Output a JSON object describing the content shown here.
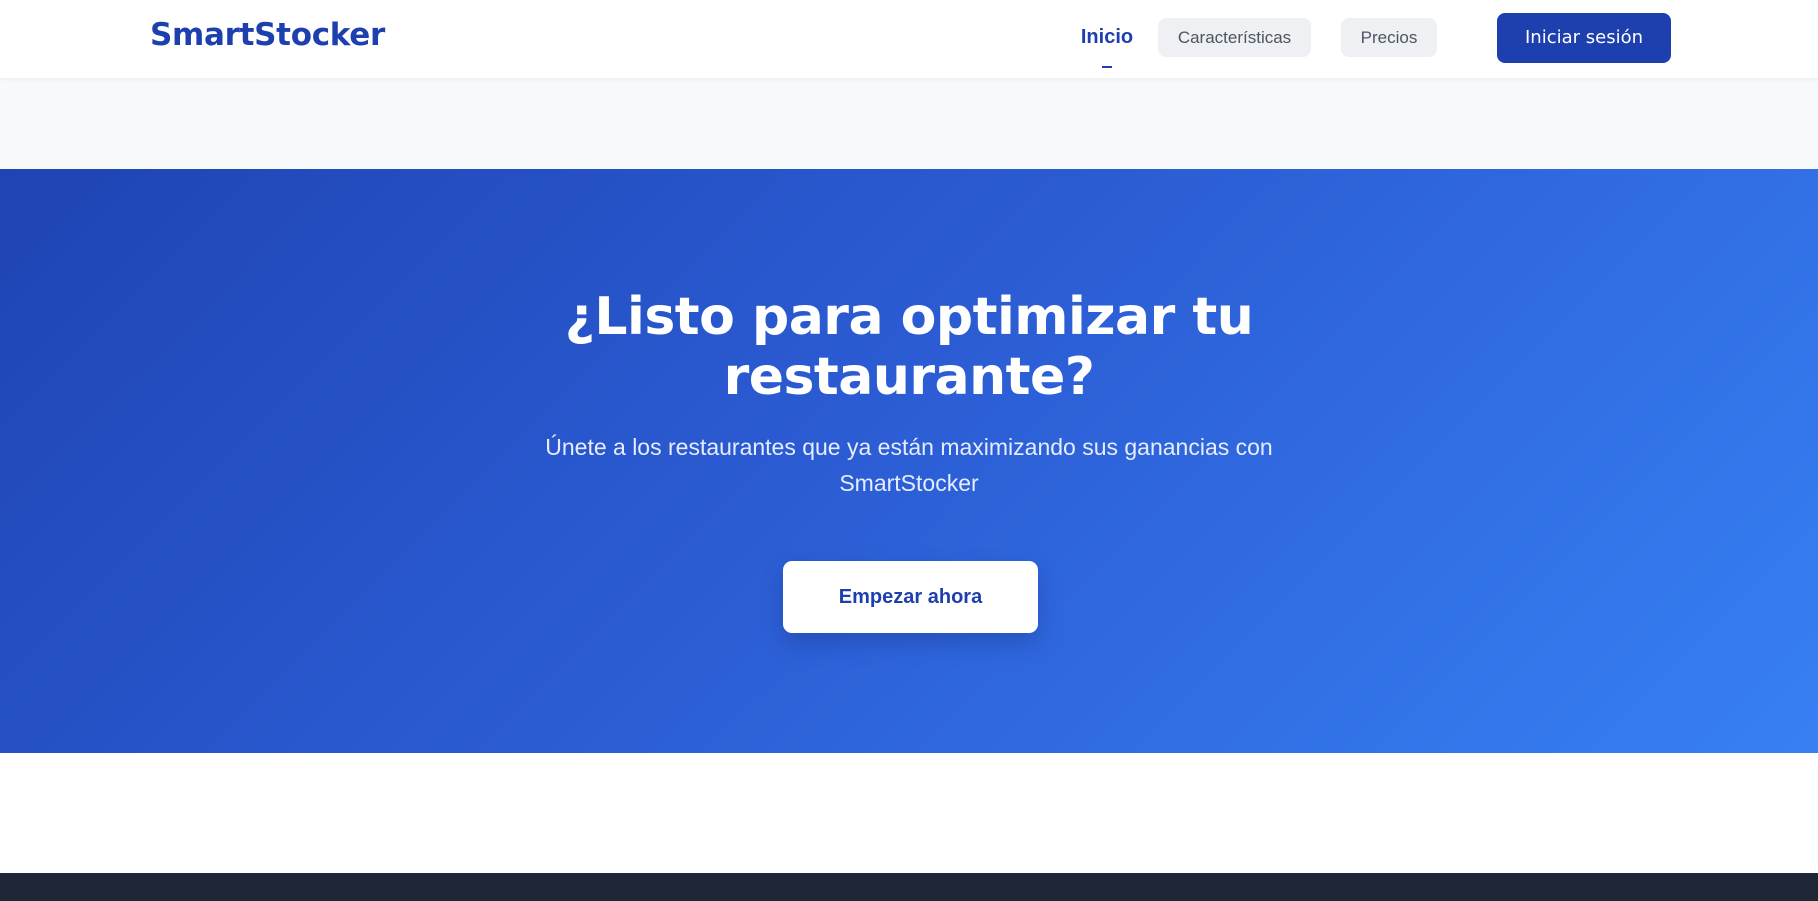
{
  "brand": {
    "name": "SmartStocker",
    "color": "#1e40af"
  },
  "nav": {
    "items": [
      {
        "label": "Inicio",
        "active": true
      },
      {
        "label": "Características",
        "active": false
      },
      {
        "label": "Precios",
        "active": false
      }
    ],
    "login_label": "Iniciar sesión"
  },
  "cta": {
    "title": "¿Listo para optimizar tu restaurante?",
    "subtitle": "Únete a los restaurantes que ya están maximizando sus ganancias con SmartStocker",
    "button_label": "Empezar ahora",
    "gradient_start": "#1f44b3",
    "gradient_end": "#3780f4"
  },
  "footer": {
    "background": "#1f2737"
  }
}
